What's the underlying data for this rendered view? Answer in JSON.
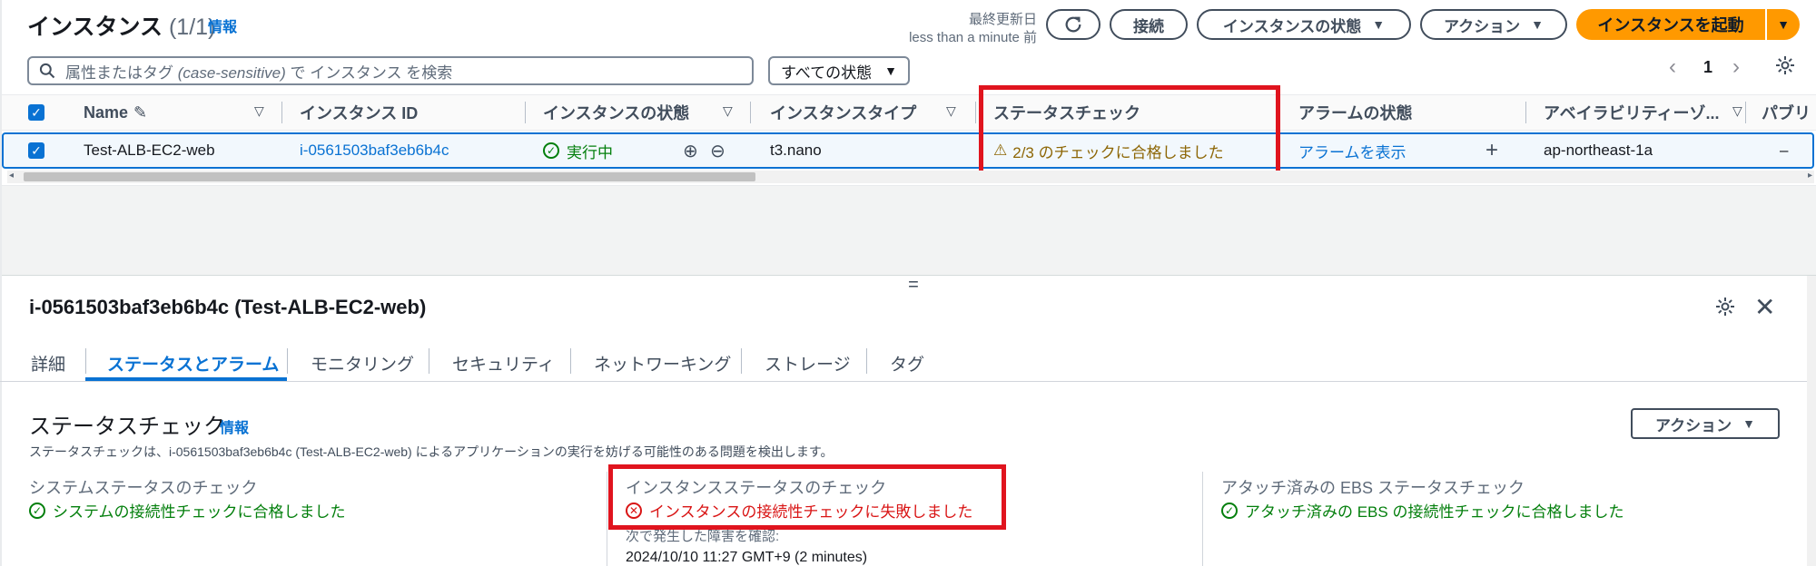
{
  "header": {
    "title": "インスタンス",
    "count": "(1/1)",
    "info": "情報",
    "last_updated_label": "最終更新日",
    "last_updated_value": "less than a minute 前",
    "connect": "接続",
    "instance_state": "インスタンスの状態",
    "actions": "アクション",
    "launch": "インスタンスを起動"
  },
  "search": {
    "placeholder_prefix": "属性またはタグ ",
    "placeholder_italic": "(case-sensitive)",
    "placeholder_suffix": " で インスタンス を検索",
    "filter": "すべての状態",
    "page": "1"
  },
  "table": {
    "columns": [
      "Name",
      "インスタンス ID",
      "インスタンスの状態",
      "インスタンスタイプ",
      "ステータスチェック",
      "アラームの状態",
      "アベイラビリティーゾ...",
      "パブリ"
    ],
    "row": {
      "name": "Test-ALB-EC2-web",
      "id": "i-0561503baf3eb6b4c",
      "state": "実行中",
      "type": "t3.nano",
      "status_check": "2/3 のチェックに合格しました",
      "alarm": "アラームを表示",
      "az": "ap-northeast-1a",
      "public": "–"
    }
  },
  "detail": {
    "title": "i-0561503baf3eb6b4c (Test-ALB-EC2-web)",
    "tabs": [
      "詳細",
      "ステータスとアラーム",
      "モニタリング",
      "セキュリティ",
      "ネットワーキング",
      "ストレージ",
      "タグ"
    ],
    "section_title": "ステータスチェック",
    "section_info": "情報",
    "section_desc": "ステータスチェックは、i-0561503baf3eb6b4c (Test-ALB-EC2-web) によるアプリケーションの実行を妨げる可能性のある問題を検出します。",
    "actions": "アクション",
    "system_label": "システムステータスのチェック",
    "system_value": "システムの接続性チェックに合格しました",
    "instance_label": "インスタンスステータスのチェック",
    "instance_value": "インスタンスの接続性チェックに失敗しました",
    "next_label": "次で発生した障害を確認:",
    "next_value": "2024/10/10 11:27 GMT+9 (2 minutes)",
    "ebs_label": "アタッチ済みの EBS ステータスチェック",
    "ebs_value": "アタッチ済みの EBS の接続性チェックに合格しました"
  },
  "colors": {
    "accent": "#0972d3",
    "primary_button": "#ff9900",
    "success": "#037f0c",
    "error": "#d91515",
    "warning": "#8d6605",
    "highlight_box": "#e0141e"
  }
}
